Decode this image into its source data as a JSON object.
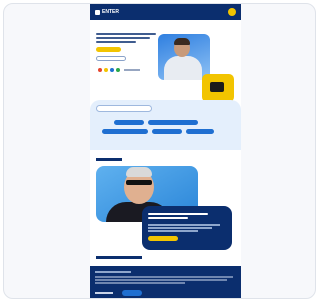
{
  "header": {
    "logo_text": "ENTER",
    "menu_icon": "menu-icon"
  },
  "hero": {
    "photo": "person-photo",
    "badge_icon": "product-icon"
  },
  "filters": {
    "chips": [
      "",
      "",
      "",
      "",
      ""
    ]
  },
  "colors": {
    "navy": "#0b2e6e",
    "yellow": "#f2c400",
    "blue": "#1f6fd1",
    "light_blue": "#e4effc"
  }
}
